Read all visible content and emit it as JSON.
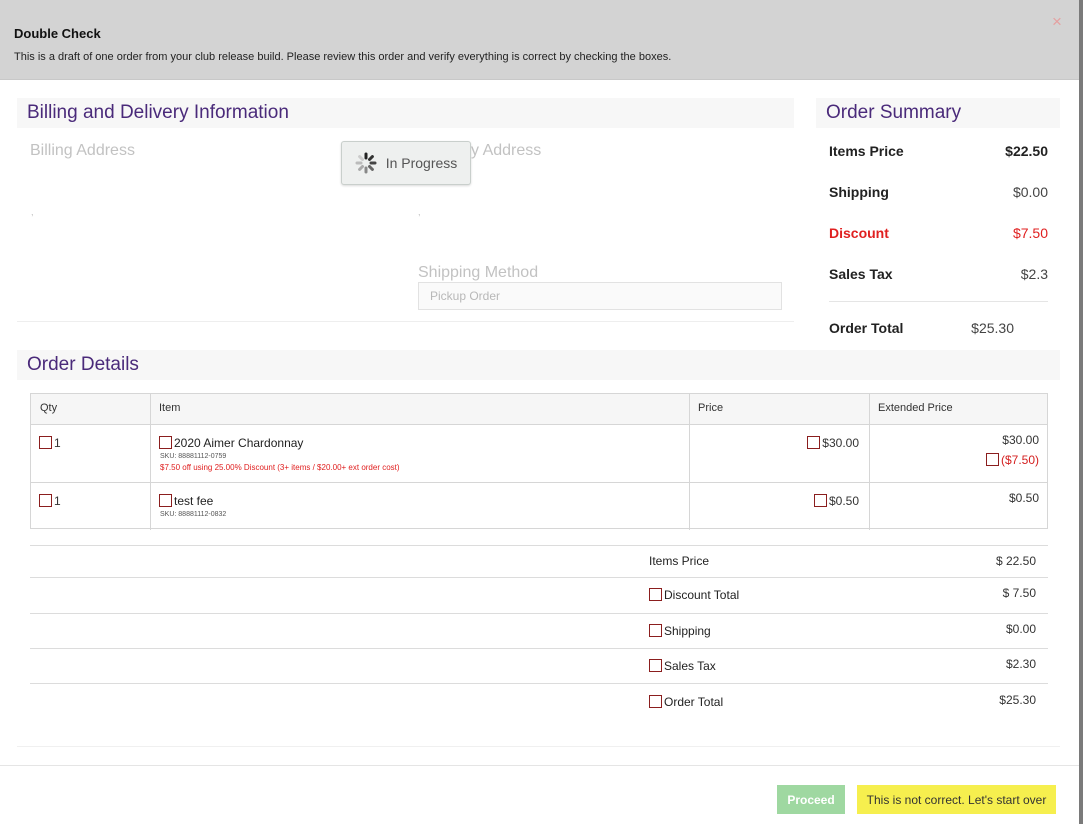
{
  "modal": {
    "title": "Double Check",
    "description": "This is a draft of one order from your club release build. Please review this order and verify everything is correct by checking the boxes.",
    "close_glyph": "×"
  },
  "billing": {
    "title": "Billing and Delivery Information",
    "billing_address_label": "Billing Address",
    "delivery_address_label_visible": "y Address",
    "shipping_method_label": "Shipping Method",
    "shipping_method_value": "Pickup Order",
    "billing_address_value": ",",
    "delivery_address_value": ","
  },
  "progress": {
    "label": "In Progress"
  },
  "summary": {
    "title": "Order Summary",
    "items_price_label": "Items Price",
    "items_price_value": "$22.50",
    "shipping_label": "Shipping",
    "shipping_value": "$0.00",
    "discount_label": "Discount",
    "discount_value": "$7.50",
    "sales_tax_label": "Sales Tax",
    "sales_tax_value": "$2.3",
    "order_total_label": "Order Total",
    "order_total_value": "$25.30"
  },
  "details": {
    "title": "Order Details",
    "columns": {
      "qty": "Qty",
      "item": "Item",
      "price": "Price",
      "extended": "Extended Price"
    },
    "rows": [
      {
        "qty": "1",
        "name": "2020 Aimer Chardonnay",
        "sku": "SKU: 88881112-0759",
        "discount_note": "$7.50 off using 25.00% Discount (3+ items / $20.00+ ext order cost)",
        "price": "$30.00",
        "extended": "$30.00",
        "extended_discount": "($7.50)"
      },
      {
        "qty": "1",
        "name": "test fee",
        "sku": "SKU: 88881112-0832",
        "price": "$0.50",
        "extended": "$0.50"
      }
    ]
  },
  "totals": {
    "items_price_label": "Items Price",
    "items_price_value": "$ 22.50",
    "discount_label": "Discount Total",
    "discount_value": "$ 7.50",
    "shipping_label": "Shipping",
    "shipping_value": "$0.00",
    "sales_tax_label": "Sales Tax",
    "sales_tax_value": "$2.30",
    "order_total_label": "Order Total",
    "order_total_value": "$25.30"
  },
  "footer": {
    "proceed_label": "Proceed",
    "restart_label": "This is not correct. Let's start over"
  },
  "colors": {
    "title_purple": "#4a2a7a",
    "discount_red": "#e02020",
    "checkbox_border": "#8b1e1e",
    "proceed_green": "#9fd8a1",
    "restart_yellow": "#f6ef4e"
  }
}
